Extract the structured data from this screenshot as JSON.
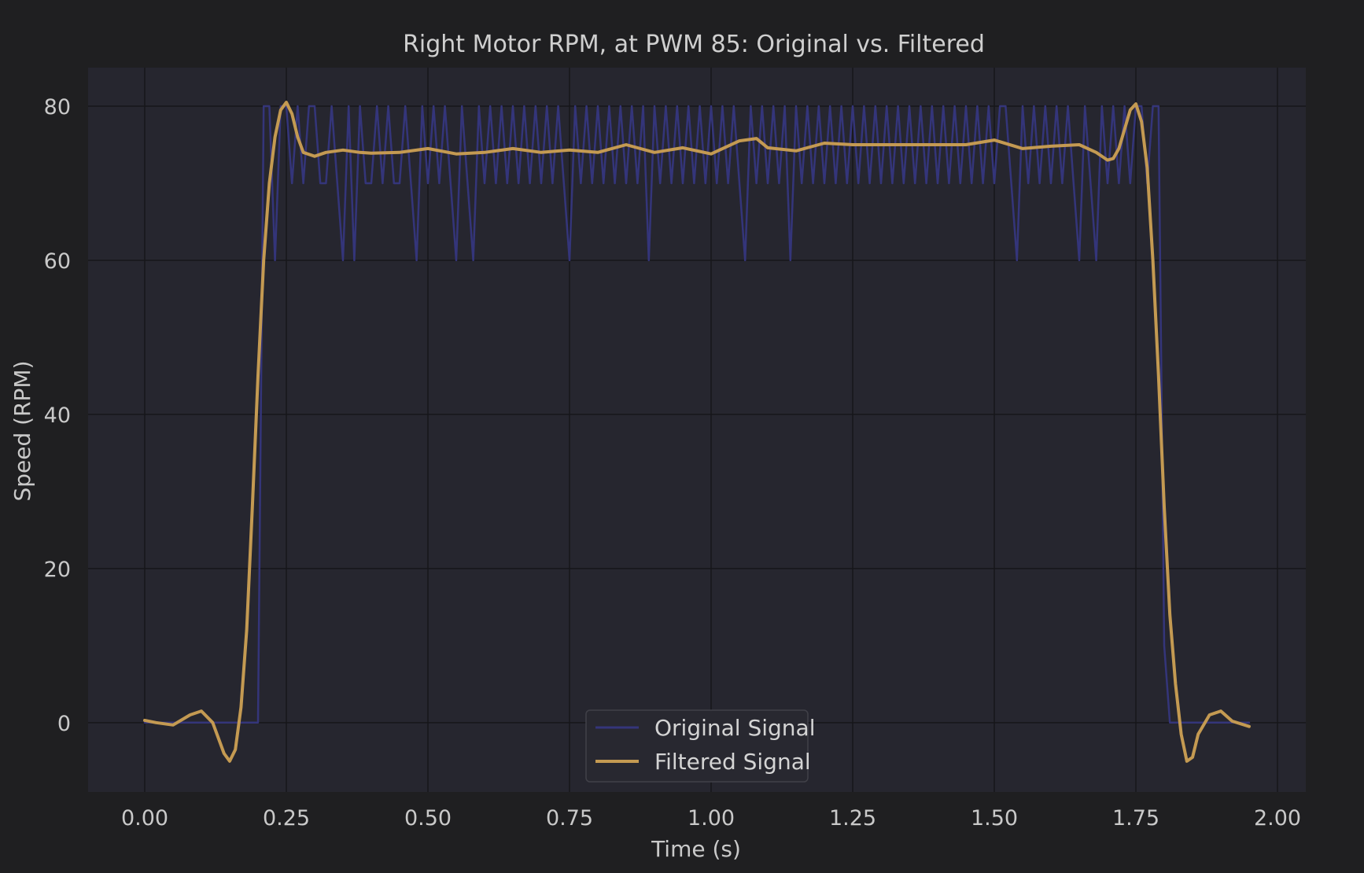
{
  "chart_data": {
    "type": "line",
    "title": "Right Motor RPM, at PWM 85: Original vs. Filtered",
    "xlabel": "Time (s)",
    "ylabel": "Speed (RPM)",
    "xlim": [
      -0.1,
      2.05
    ],
    "ylim": [
      -9,
      85
    ],
    "xticks": [
      0.0,
      0.25,
      0.5,
      0.75,
      1.0,
      1.25,
      1.5,
      1.75,
      2.0
    ],
    "xtick_labels": [
      "0.00",
      "0.25",
      "0.50",
      "0.75",
      "1.00",
      "1.25",
      "1.50",
      "1.75",
      "2.00"
    ],
    "yticks": [
      0,
      20,
      40,
      60,
      80
    ],
    "ytick_labels": [
      "0",
      "20",
      "40",
      "60",
      "80"
    ],
    "grid": true,
    "legend_position": "bottom-center",
    "colors": {
      "figure_bg": "#1f1f21",
      "axes_bg": "#26262f",
      "grid": "#16161a",
      "original": "#34357a",
      "filtered": "#c49a52",
      "text": "#c9c9c9"
    },
    "series": [
      {
        "name": "Original Signal",
        "x": [
          0.0,
          0.01,
          0.02,
          0.03,
          0.04,
          0.05,
          0.06,
          0.07,
          0.08,
          0.09,
          0.1,
          0.11,
          0.12,
          0.13,
          0.14,
          0.15,
          0.16,
          0.17,
          0.18,
          0.19,
          0.2,
          0.21,
          0.22,
          0.23,
          0.24,
          0.25,
          0.26,
          0.27,
          0.28,
          0.29,
          0.3,
          0.31,
          0.32,
          0.33,
          0.34,
          0.35,
          0.36,
          0.37,
          0.38,
          0.39,
          0.4,
          0.41,
          0.42,
          0.43,
          0.44,
          0.45,
          0.46,
          0.47,
          0.48,
          0.49,
          0.5,
          0.51,
          0.52,
          0.53,
          0.54,
          0.55,
          0.56,
          0.57,
          0.58,
          0.59,
          0.6,
          0.61,
          0.62,
          0.63,
          0.64,
          0.65,
          0.66,
          0.67,
          0.68,
          0.69,
          0.7,
          0.71,
          0.72,
          0.73,
          0.74,
          0.75,
          0.76,
          0.77,
          0.78,
          0.79,
          0.8,
          0.81,
          0.82,
          0.83,
          0.84,
          0.85,
          0.86,
          0.87,
          0.88,
          0.89,
          0.9,
          0.91,
          0.92,
          0.93,
          0.94,
          0.95,
          0.96,
          0.97,
          0.98,
          0.99,
          1.0,
          1.01,
          1.02,
          1.03,
          1.04,
          1.05,
          1.06,
          1.07,
          1.08,
          1.09,
          1.1,
          1.11,
          1.12,
          1.13,
          1.14,
          1.15,
          1.16,
          1.17,
          1.18,
          1.19,
          1.2,
          1.21,
          1.22,
          1.23,
          1.24,
          1.25,
          1.26,
          1.27,
          1.28,
          1.29,
          1.3,
          1.31,
          1.32,
          1.33,
          1.34,
          1.35,
          1.36,
          1.37,
          1.38,
          1.39,
          1.4,
          1.41,
          1.42,
          1.43,
          1.44,
          1.45,
          1.46,
          1.47,
          1.48,
          1.49,
          1.5,
          1.51,
          1.52,
          1.53,
          1.54,
          1.55,
          1.56,
          1.57,
          1.58,
          1.59,
          1.6,
          1.61,
          1.62,
          1.63,
          1.64,
          1.65,
          1.66,
          1.67,
          1.68,
          1.69,
          1.7,
          1.71,
          1.72,
          1.73,
          1.74,
          1.75,
          1.76,
          1.77,
          1.78,
          1.79,
          1.8,
          1.81,
          1.82,
          1.83,
          1.84,
          1.85,
          1.86,
          1.87,
          1.88,
          1.89,
          1.9,
          1.91,
          1.92,
          1.93,
          1.94,
          1.95
        ],
        "values": [
          0,
          0,
          0,
          0,
          0,
          0,
          0,
          0,
          0,
          0,
          0,
          0,
          0,
          0,
          0,
          0,
          0,
          0,
          0,
          0,
          0,
          80,
          80,
          60,
          80,
          80,
          70,
          80,
          70,
          80,
          80,
          70,
          70,
          80,
          70,
          60,
          80,
          60,
          80,
          70,
          70,
          80,
          70,
          80,
          70,
          70,
          80,
          70,
          60,
          80,
          70,
          80,
          70,
          80,
          70,
          60,
          80,
          70,
          60,
          80,
          70,
          80,
          70,
          80,
          70,
          80,
          70,
          80,
          70,
          80,
          70,
          80,
          70,
          80,
          70,
          60,
          80,
          70,
          80,
          70,
          80,
          70,
          80,
          70,
          80,
          70,
          80,
          70,
          80,
          60,
          80,
          70,
          80,
          70,
          80,
          70,
          80,
          70,
          80,
          70,
          80,
          70,
          80,
          70,
          80,
          70,
          60,
          80,
          70,
          80,
          70,
          80,
          70,
          80,
          60,
          80,
          70,
          80,
          70,
          80,
          70,
          80,
          70,
          80,
          70,
          80,
          70,
          80,
          70,
          80,
          70,
          80,
          70,
          80,
          70,
          80,
          70,
          80,
          70,
          80,
          70,
          80,
          70,
          80,
          70,
          80,
          70,
          80,
          70,
          80,
          70,
          80,
          80,
          70,
          60,
          80,
          70,
          80,
          70,
          80,
          70,
          80,
          70,
          80,
          70,
          60,
          80,
          70,
          60,
          80,
          70,
          80,
          70,
          80,
          70,
          80,
          80,
          70,
          80,
          80,
          10,
          0,
          0,
          0,
          0,
          0,
          0,
          0,
          0,
          0,
          0,
          0,
          0,
          0,
          0,
          0
        ]
      },
      {
        "name": "Filtered Signal",
        "x": [
          0.0,
          0.02,
          0.05,
          0.08,
          0.1,
          0.12,
          0.14,
          0.15,
          0.16,
          0.17,
          0.18,
          0.19,
          0.2,
          0.21,
          0.22,
          0.23,
          0.24,
          0.25,
          0.26,
          0.27,
          0.28,
          0.3,
          0.32,
          0.35,
          0.38,
          0.4,
          0.45,
          0.5,
          0.55,
          0.6,
          0.65,
          0.7,
          0.75,
          0.8,
          0.85,
          0.9,
          0.95,
          1.0,
          1.05,
          1.08,
          1.1,
          1.15,
          1.2,
          1.25,
          1.3,
          1.35,
          1.4,
          1.45,
          1.5,
          1.55,
          1.6,
          1.65,
          1.68,
          1.7,
          1.71,
          1.72,
          1.73,
          1.74,
          1.75,
          1.76,
          1.77,
          1.78,
          1.79,
          1.8,
          1.81,
          1.82,
          1.83,
          1.84,
          1.85,
          1.86,
          1.88,
          1.9,
          1.92,
          1.95
        ],
        "values": [
          0.3,
          0.0,
          -0.3,
          1.0,
          1.5,
          0.0,
          -4.0,
          -5.0,
          -3.5,
          2.0,
          12.0,
          28.0,
          45.0,
          60.0,
          70.0,
          76.0,
          79.5,
          80.5,
          79.0,
          76.0,
          74.0,
          73.5,
          74.0,
          74.3,
          74.0,
          73.9,
          74.0,
          74.5,
          73.8,
          74.0,
          74.5,
          74.0,
          74.3,
          74.0,
          75.0,
          74.0,
          74.6,
          73.8,
          75.5,
          75.8,
          74.6,
          74.2,
          75.2,
          75.0,
          75.0,
          75.0,
          75.0,
          75.0,
          75.6,
          74.5,
          74.8,
          75.0,
          74.0,
          73.0,
          73.2,
          74.5,
          77.0,
          79.5,
          80.3,
          78.0,
          72.0,
          60.0,
          45.0,
          28.0,
          14.0,
          5.0,
          -1.5,
          -5.0,
          -4.5,
          -1.5,
          1.0,
          1.5,
          0.2,
          -0.5
        ]
      }
    ]
  }
}
